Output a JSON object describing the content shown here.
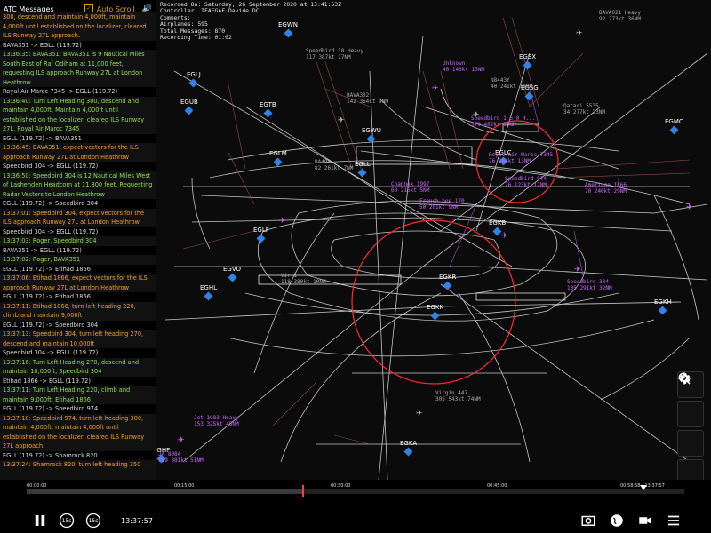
{
  "atc_panel": {
    "title": "ATC Messages",
    "autoscroll_label": "Auto Scroll",
    "messages": [
      {
        "kind": "orange",
        "text": "300, descend and maintain 4,000ft, maintain 4,000ft until established on the localizer, cleared ILS Runway 27L approach."
      },
      {
        "kind": "head",
        "text": "BAVA351 -> EGLL (119.72)"
      },
      {
        "kind": "green",
        "text": "13:36:35: BAVA351: BAVA351 is 9 Nautical Miles South East of Raf Odiham at 11,000 feet, requesting ILS approach Runway 27L at London Heathrow"
      },
      {
        "kind": "head",
        "text": "Royal Air Maroc 7345 -> EGLL (119.72)"
      },
      {
        "kind": "green",
        "text": "13:36:40: Turn Left Heading 300, descend and maintain 4,000ft, Maintain 4,000ft until established on the localizer, cleared ILS Runway 27L, Royal Air Maroc 7345"
      },
      {
        "kind": "head",
        "text": "EGLL (119.72) -> BAVA351"
      },
      {
        "kind": "orange",
        "text": "13:36:45: BAVA351: expect vectors for the ILS approach Runway 27L at London Heathrow"
      },
      {
        "kind": "head",
        "text": "Speedbird 304 -> EGLL (119.72)"
      },
      {
        "kind": "green",
        "text": "13:36:50: Speedbird 304 is 12 Nautical Miles West of Lashenden Headcorn at 11,800 feet, Requesting Radar Vectors to London Heathrow"
      },
      {
        "kind": "head",
        "text": "EGLL (119.72) -> Speedbird 304"
      },
      {
        "kind": "orange",
        "text": "13:37:01: Speedbird 304, expect vectors for the ILS approach Runway 27L at London Heathrow"
      },
      {
        "kind": "head",
        "text": "Speedbird 304 -> EGLL (119.72)"
      },
      {
        "kind": "green",
        "text": "13:37:03: Roger, Speedbird 304"
      },
      {
        "kind": "head",
        "text": "BAVA351 -> EGLL (119.72)"
      },
      {
        "kind": "green",
        "text": "13:37:02: Roger, BAVA351"
      },
      {
        "kind": "head",
        "text": "EGLL (119.72) -> Etihad 1866"
      },
      {
        "kind": "orange",
        "text": "13:37:06: Etihad 1866, expect vectors for the ILS approach Runway 27L at London Heathrow"
      },
      {
        "kind": "head",
        "text": "EGLL (119.72) -> Etihad 1866"
      },
      {
        "kind": "orange",
        "text": "13:37:11: Etihad 1866, turn left heading 220, climb and maintain 9,000ft"
      },
      {
        "kind": "head",
        "text": "EGLL (119.72) -> Speedbird 304"
      },
      {
        "kind": "orange",
        "text": "13:37:13: Speedbird 304, turn left heading 270, descend and maintain 10,000ft"
      },
      {
        "kind": "head",
        "text": "Speedbird 304 -> EGLL (119.72)"
      },
      {
        "kind": "green",
        "text": "13:37:16: Turn Left Heading 270, descend and maintain 10,000ft, Speedbird 304"
      },
      {
        "kind": "head",
        "text": "Etihad 1866 -> EGLL (119.72)"
      },
      {
        "kind": "green",
        "text": "13:37:11: Turn Left Heading 220, climb and maintain 9,000ft, Etihad 1866"
      },
      {
        "kind": "head",
        "text": "EGLL (119.72) -> Speedbird 974"
      },
      {
        "kind": "orange",
        "text": "13:37:18: Speedbird 974, turn left heading 300, maintain 4,000ft, maintain 4,000ft until established on the localizer, cleared ILS Runway 27L approach."
      },
      {
        "kind": "head",
        "text": "EGLL (119.72) -> Shamrock 820"
      },
      {
        "kind": "orange",
        "text": "13:37:24: Shamrock 820, turn left heading 350"
      }
    ]
  },
  "recording": {
    "line1": "Recorded On: Saturday, 26 September 2020 at 13:41:53Z",
    "line2": "Controller: IFAEGAF Davide DC",
    "line3": "Comments:",
    "line4": "Airplanes: 595",
    "line5": "Total Messages: 870",
    "line6": "Recording Time: 01:02"
  },
  "airports": [
    "EGWN",
    "EGLJ",
    "EGUB",
    "EGTB",
    "EGWU",
    "EGSX",
    "EGSG",
    "EGMC",
    "EGLM",
    "EGLL",
    "EGKB",
    "EGLC",
    "EGLF",
    "EGVO",
    "EGHL",
    "EGKR",
    "EGKK",
    "EGKH",
    "EGKA",
    "EGHF"
  ],
  "aircraft_labels": [
    {
      "id": "bava021",
      "name": "BAVA021 Heavy",
      "info": "92 273kt 36NM"
    },
    {
      "id": "speedbird10",
      "name": "Speedbird 10 Heavy",
      "info": "117 387kt 17NM"
    },
    {
      "id": "unknown",
      "name": "Unknown",
      "info": "40 143kt 15NM"
    },
    {
      "id": "n8443y",
      "name": "N8443Y",
      "info": "40 241kt 18NM"
    },
    {
      "id": "qatari",
      "name": "Qatari 5535",
      "info": "34 277kt 23NM"
    },
    {
      "id": "bava302",
      "name": "BAVA302",
      "info": "142 364kt 9NM"
    },
    {
      "id": "speedbird_heavy",
      "name": "Speedbird 1 6 0 H...",
      "info": "370 452kt 14NM"
    },
    {
      "id": "royal",
      "name": "Royal Air Maroc 7345",
      "info": "76 284kt 13NM"
    },
    {
      "id": "ba490",
      "name": "BA490",
      "info": "82 261kt 7NM"
    },
    {
      "id": "speedbird974",
      "name": "Speedbird 974",
      "info": "76 123kt 12NM"
    },
    {
      "id": "american",
      "name": "American 1866",
      "info": "70 240kt 29NM"
    },
    {
      "id": "channex",
      "name": "Channex 1997",
      "info": "60 215kt 5NM"
    },
    {
      "id": "frenchbee",
      "name": "French bee 170",
      "info": "50 201kt 9NM"
    },
    {
      "id": "vir",
      "name": "Vir 1",
      "info": "118 380kt 10NM"
    },
    {
      "id": "speedbird304",
      "name": "Speedbird 304",
      "info": "105 291kt 32NM"
    },
    {
      "id": "virgin447",
      "name": "Virgin 447",
      "info": "305 543kt 74NM"
    },
    {
      "id": "jet1983",
      "name": "Jet 1983 Heavy",
      "info": "153 325kt 45NM"
    },
    {
      "id": "ja8084",
      "name": "JA 8084",
      "info": "189 381kt 51NM"
    }
  ],
  "timeline": {
    "ticks": [
      "00:00:00",
      "00:15:00",
      "00:30:00",
      "00:45:00"
    ],
    "current": "13:37:57",
    "range": "00:58:58 - 13:37:57"
  },
  "controls": {
    "skip_back_label": "15s",
    "skip_fwd_label": "15s"
  },
  "icons": {
    "speaker": "speaker-icon",
    "settings": "gear-icon",
    "zoom_in": "zoom-in-icon",
    "zoom_out": "zoom-out-icon",
    "recenter": "recenter-icon",
    "screenshot": "camera-icon",
    "globe": "globe-icon",
    "video": "video-icon",
    "menu": "menu-icon"
  }
}
